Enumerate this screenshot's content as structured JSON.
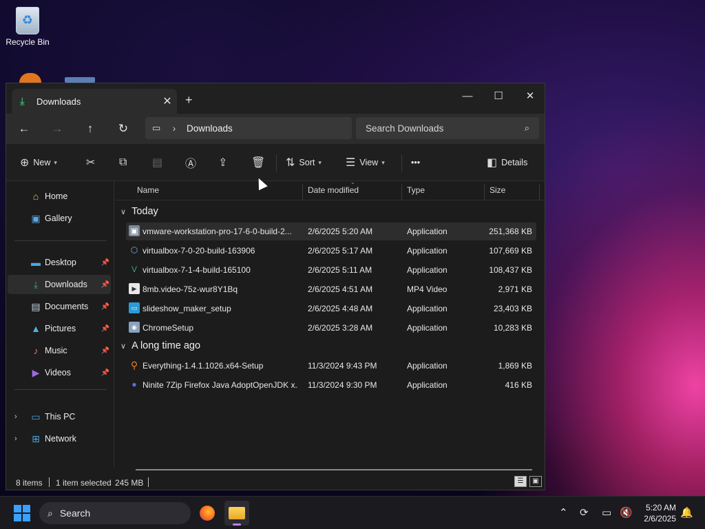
{
  "desktop": {
    "recycle_bin_label": "Recycle Bin"
  },
  "window": {
    "tab_title": "Downloads",
    "new_tab_symbol": "+",
    "controls": {
      "minimize": "—",
      "maximize": "☐",
      "close": "✕"
    }
  },
  "address": {
    "breadcrumb": "Downloads",
    "search_placeholder": "Search Downloads"
  },
  "toolbar": {
    "new_label": "New",
    "sort_label": "Sort",
    "view_label": "View",
    "more_label": "•••",
    "details_label": "Details"
  },
  "nav": {
    "home": "Home",
    "gallery": "Gallery",
    "desktop": "Desktop",
    "downloads": "Downloads",
    "documents": "Documents",
    "pictures": "Pictures",
    "music": "Music",
    "videos": "Videos",
    "this_pc": "This PC",
    "network": "Network"
  },
  "columns": {
    "name": "Name",
    "date": "Date modified",
    "type": "Type",
    "size": "Size"
  },
  "groups": {
    "today": "Today",
    "long_ago": "A long time ago"
  },
  "files_today": [
    {
      "name": "vmware-workstation-pro-17-6-0-build-2...",
      "date": "2/6/2025 5:20 AM",
      "type": "Application",
      "size": "251,368 KB",
      "icon": "vmware-installer-icon"
    },
    {
      "name": "virtualbox-7-0-20-build-163906",
      "date": "2/6/2025 5:17 AM",
      "type": "Application",
      "size": "107,669 KB",
      "icon": "virtualbox-icon"
    },
    {
      "name": "virtualbox-7-1-4-build-165100",
      "date": "2/6/2025 5:11 AM",
      "type": "Application",
      "size": "108,437 KB",
      "icon": "virtualbox-icon"
    },
    {
      "name": "8mb.video-75z-wur8Y1Bq",
      "date": "2/6/2025 4:51 AM",
      "type": "MP4 Video",
      "size": "2,971 KB",
      "icon": "video-file-icon"
    },
    {
      "name": "slideshow_maker_setup",
      "date": "2/6/2025 4:48 AM",
      "type": "Application",
      "size": "23,403 KB",
      "icon": "slideshow-app-icon"
    },
    {
      "name": "ChromeSetup",
      "date": "2/6/2025 3:28 AM",
      "type": "Application",
      "size": "10,283 KB",
      "icon": "chrome-setup-icon"
    }
  ],
  "files_old": [
    {
      "name": "Everything-1.4.1.1026.x64-Setup",
      "date": "11/3/2024 9:43 PM",
      "type": "Application",
      "size": "1,869 KB",
      "icon": "everything-search-icon"
    },
    {
      "name": "Ninite 7Zip Firefox Java AdoptOpenJDK x...",
      "date": "11/3/2024 9:30 PM",
      "type": "Application",
      "size": "416 KB",
      "icon": "ninite-icon"
    }
  ],
  "status": {
    "items": "8 items",
    "selected": "1 item selected",
    "selected_size": "245 MB"
  },
  "taskbar": {
    "search_label": "Search",
    "time": "5:20 AM",
    "date": "2/6/2025"
  }
}
